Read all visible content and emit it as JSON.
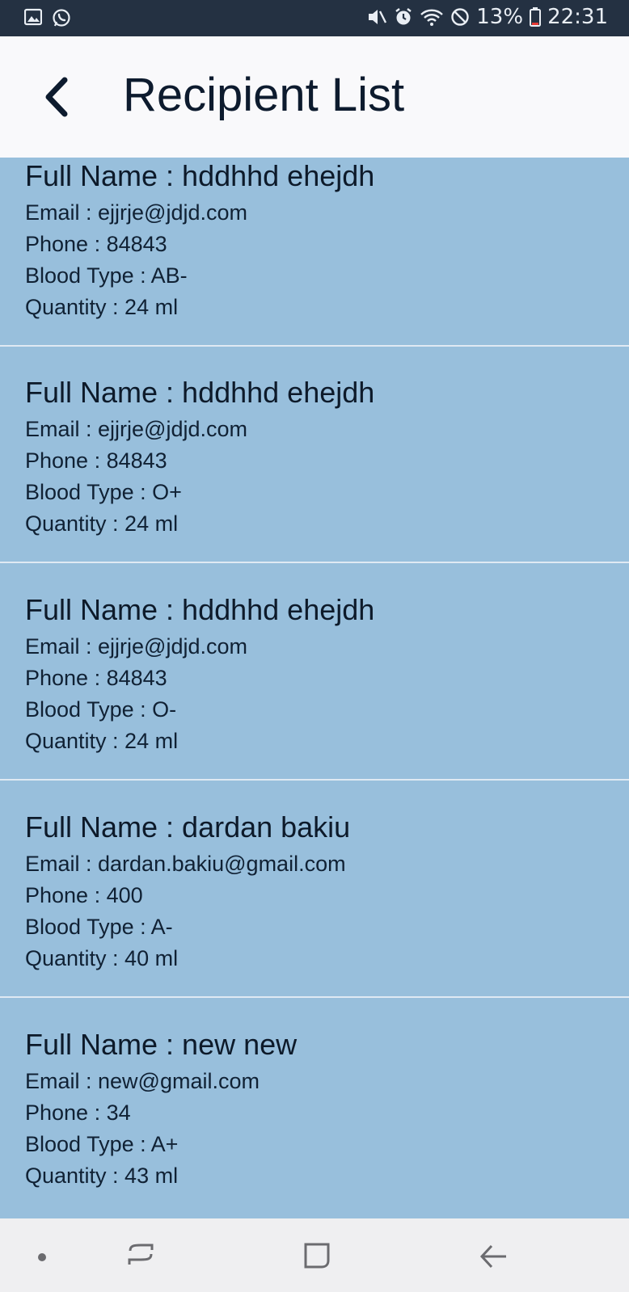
{
  "status_bar": {
    "left_icons": [
      "gallery-icon",
      "whatsapp-icon"
    ],
    "right_icons": [
      "mute-icon",
      "alarm-icon",
      "wifi-icon",
      "do-not-disturb-icon",
      "battery-icon"
    ],
    "battery": "13%",
    "time": "22:31"
  },
  "header": {
    "title": "Recipient List",
    "back_icon": "chevron-left-icon"
  },
  "recipients": [
    {
      "full_name": "Full Name : hddhhd ehejdh",
      "email": "Email : ejjrje@jdjd.com",
      "phone": "Phone : 84843",
      "blood_type": "Blood Type : AB-",
      "quantity": "Quantity : 24 ml"
    },
    {
      "full_name": "Full Name : hddhhd ehejdh",
      "email": "Email : ejjrje@jdjd.com",
      "phone": "Phone : 84843",
      "blood_type": "Blood Type : O+",
      "quantity": "Quantity : 24 ml"
    },
    {
      "full_name": "Full Name : hddhhd ehejdh",
      "email": "Email : ejjrje@jdjd.com",
      "phone": "Phone : 84843",
      "blood_type": "Blood Type : O-",
      "quantity": "Quantity : 24 ml"
    },
    {
      "full_name": "Full Name : dardan bakiu",
      "email": "Email : dardan.bakiu@gmail.com",
      "phone": "Phone : 400",
      "blood_type": "Blood Type : A-",
      "quantity": "Quantity : 40 ml"
    },
    {
      "full_name": "Full Name : new new",
      "email": "Email : new@gmail.com",
      "phone": "Phone : 34",
      "blood_type": "Blood Type : A+",
      "quantity": "Quantity : 43 ml"
    }
  ],
  "nav_bar": {
    "buttons": [
      "dot-icon",
      "recent-apps-icon",
      "home-icon",
      "back-arrow-icon"
    ]
  },
  "colors": {
    "status_bar": "#243142",
    "app_bar": "#f9f9fb",
    "card_background": "#98bfdc",
    "divider": "#dfe9f3",
    "text": "#0d1a2a",
    "nav_bar": "#efeff1"
  }
}
